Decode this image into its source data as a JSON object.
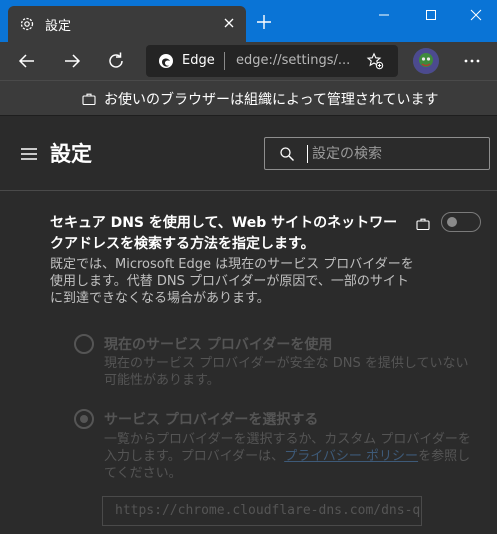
{
  "browser": {
    "tab_title": "設定",
    "site_name": "Edge",
    "url": "edge://settings/...",
    "managed_notice": "お使いのブラウザーは組織によって管理されています"
  },
  "settings": {
    "title": "設定",
    "search_placeholder": "設定の検索"
  },
  "dns": {
    "title": "セキュア DNS を使用して、Web サイトのネットワークアドレスを検索する方法を指定します。",
    "description": "既定では、Microsoft Edge は現在のサービス プロバイダーを使用します。代替 DNS プロバイダーが原因で、一部のサイトに到達できなくなる場合があります。",
    "toggle_on": false,
    "option_current": {
      "title": "現在のサービス プロバイダーを使用",
      "description": "現在のサービス プロバイダーが安全な DNS を提供していない可能性があります。"
    },
    "option_choose": {
      "title": "サービス プロバイダーを選択する",
      "description_before": "一覧からプロバイダーを選択するか、カスタム プロバイダーを入力します。プロバイダーは、",
      "link": "プライバシー ポリシー",
      "description_after": "を参照してください。",
      "provider_value": "https://chrome.cloudflare-dns.com/dns-q"
    }
  },
  "colors": {
    "titlebar": "#0a74d6",
    "chrome": "#3b3b3b",
    "page": "#2b2b2b",
    "disabled": "#555555"
  }
}
